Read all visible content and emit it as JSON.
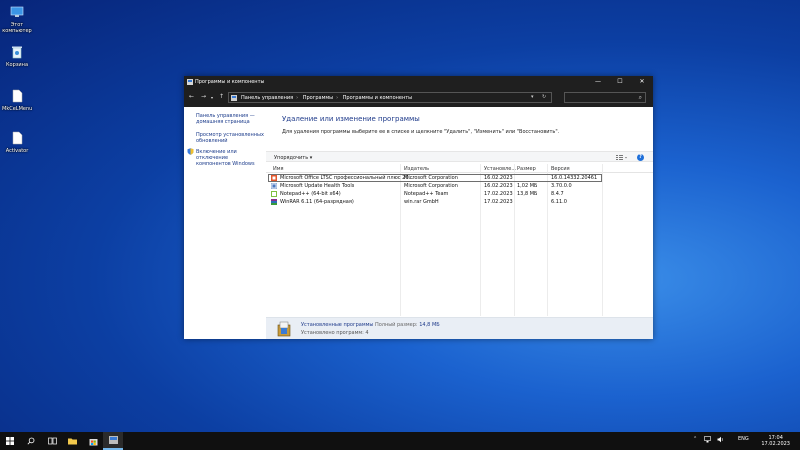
{
  "desktop": {
    "icons": [
      {
        "label": "Этот компьютер"
      },
      {
        "label": "Корзина"
      },
      {
        "label": "MkCeLMenu"
      },
      {
        "label": "Activator"
      }
    ]
  },
  "window": {
    "title": "Программы и компоненты",
    "controls": {
      "minimize": "—",
      "maximize": "☐",
      "close": "✕"
    },
    "breadcrumb": [
      "Панель управления",
      "Программы",
      "Программы и компоненты"
    ],
    "search_placeholder": "",
    "left_pane": {
      "links": [
        "Панель управления — домашняя страница",
        "Просмотр установленных обновлений",
        "Включение или отключение компонентов Windows"
      ]
    },
    "content": {
      "title": "Удаление или изменение программы",
      "description": "Для удаления программы выберите ее в списке и щелкните \"Удалить\", \"Изменить\" или \"Восстановить\".",
      "toolbar": {
        "organize": "Упорядочить ▾"
      },
      "columns": [
        "Имя",
        "Издатель",
        "Установле...",
        "Размер",
        "Версия"
      ],
      "rows": [
        {
          "name": "Microsoft Office LTSC профессиональный плюс 20...",
          "publisher": "Microsoft Corporation",
          "installed": "16.02.2023",
          "size": "",
          "version": "16.0.14332.20461",
          "icon": "office-icon",
          "selected": true
        },
        {
          "name": "Microsoft Update Health Tools",
          "publisher": "Microsoft Corporation",
          "installed": "16.02.2023",
          "size": "1,02 МБ",
          "version": "3.70.0.0",
          "icon": "installer-icon",
          "selected": false
        },
        {
          "name": "Notepad++ (64-bit x64)",
          "publisher": "Notepad++ Team",
          "installed": "17.02.2023",
          "size": "13,8 МБ",
          "version": "8.4.7",
          "icon": "notepad-icon",
          "selected": false
        },
        {
          "name": "WinRAR 6.11 (64-разрядная)",
          "publisher": "win.rar GmbH",
          "installed": "17.02.2023",
          "size": "",
          "version": "6.11.0",
          "icon": "winrar-icon",
          "selected": false
        }
      ],
      "status": {
        "label": "Установленные программы",
        "total_label": "Полный размер:",
        "total_value": "14,8 МБ",
        "count_text": "Установлено программ: 4"
      }
    }
  },
  "taskbar": {
    "tray_lang": "ENG",
    "clock_time": "17:04",
    "clock_date": "17.02.2023"
  },
  "colors": {
    "accent": "#1e6fd9",
    "link": "#1a3a8a"
  }
}
